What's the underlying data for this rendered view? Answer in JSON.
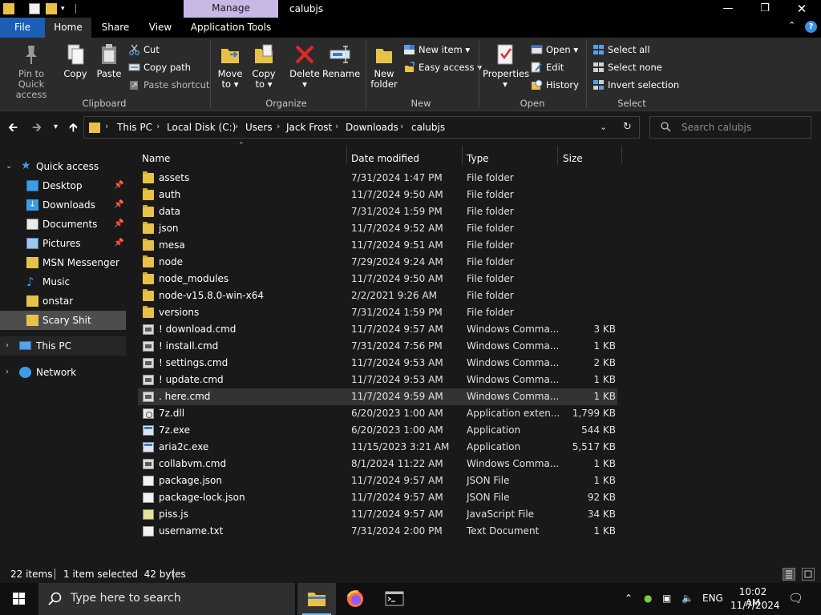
{
  "window": {
    "title": "calubjs",
    "contextual_tab_group": "Manage",
    "controls": [
      "minimize",
      "maximize",
      "close"
    ]
  },
  "ribbon_tabs": {
    "file": "File",
    "home": "Home",
    "share": "Share",
    "view": "View",
    "app_tools": "Application Tools"
  },
  "ribbon": {
    "clipboard": {
      "label": "Clipboard",
      "pin_line1": "Pin to Quick",
      "pin_line2": "access",
      "copy": "Copy",
      "paste": "Paste",
      "cut": "Cut",
      "copy_path": "Copy path",
      "paste_shortcut": "Paste shortcut"
    },
    "organize": {
      "label": "Organize",
      "move_line1": "Move",
      "move_line2": "to",
      "copy_line1": "Copy",
      "copy_line2": "to",
      "delete": "Delete",
      "rename": "Rename"
    },
    "new": {
      "label": "New",
      "new_folder_line1": "New",
      "new_folder_line2": "folder",
      "new_item": "New item",
      "easy_access": "Easy access"
    },
    "open": {
      "label": "Open",
      "properties": "Properties",
      "open": "Open",
      "edit": "Edit",
      "history": "History"
    },
    "select": {
      "label": "Select",
      "select_all": "Select all",
      "select_none": "Select none",
      "invert": "Invert selection"
    }
  },
  "address": {
    "crumbs": [
      "This PC",
      "Local Disk (C:)",
      "Users",
      "Jack Frost",
      "Downloads",
      "calubjs"
    ],
    "search_placeholder": "Search calubjs"
  },
  "navpane": {
    "quick_access": "Quick access",
    "items": [
      {
        "label": "Desktop",
        "icon": "desktop-icon",
        "pinned": true
      },
      {
        "label": "Downloads",
        "icon": "downloads-icon",
        "pinned": true
      },
      {
        "label": "Documents",
        "icon": "documents-icon",
        "pinned": true
      },
      {
        "label": "Pictures",
        "icon": "pictures-icon",
        "pinned": true
      },
      {
        "label": "MSN Messenger",
        "icon": "folder-icon",
        "pinned": false
      },
      {
        "label": "Music",
        "icon": "music-icon",
        "pinned": false
      },
      {
        "label": "onstar",
        "icon": "folder-icon",
        "pinned": false
      },
      {
        "label": "Scary Shit",
        "icon": "folder-icon",
        "pinned": false
      }
    ],
    "this_pc": "This PC",
    "network": "Network",
    "pin_glyph": "📌"
  },
  "columns": {
    "name": "Name",
    "date": "Date modified",
    "type": "Type",
    "size": "Size"
  },
  "files": [
    {
      "name": "assets",
      "date": "7/31/2024 1:47 PM",
      "type": "File folder",
      "size": "",
      "icon": "folder"
    },
    {
      "name": "auth",
      "date": "11/7/2024 9:50 AM",
      "type": "File folder",
      "size": "",
      "icon": "folder"
    },
    {
      "name": "data",
      "date": "7/31/2024 1:59 PM",
      "type": "File folder",
      "size": "",
      "icon": "folder"
    },
    {
      "name": "json",
      "date": "11/7/2024 9:52 AM",
      "type": "File folder",
      "size": "",
      "icon": "folder"
    },
    {
      "name": "mesa",
      "date": "11/7/2024 9:51 AM",
      "type": "File folder",
      "size": "",
      "icon": "folder"
    },
    {
      "name": "node",
      "date": "7/29/2024 9:24 AM",
      "type": "File folder",
      "size": "",
      "icon": "folder"
    },
    {
      "name": "node_modules",
      "date": "11/7/2024 9:50 AM",
      "type": "File folder",
      "size": "",
      "icon": "folder"
    },
    {
      "name": "node-v15.8.0-win-x64",
      "date": "2/2/2021 9:26 AM",
      "type": "File folder",
      "size": "",
      "icon": "folder"
    },
    {
      "name": "versions",
      "date": "7/31/2024 1:59 PM",
      "type": "File folder",
      "size": "",
      "icon": "folder"
    },
    {
      "name": "! download.cmd",
      "date": "11/7/2024 9:57 AM",
      "type": "Windows Comma...",
      "size": "3 KB",
      "icon": "cmd"
    },
    {
      "name": "! install.cmd",
      "date": "7/31/2024 7:56 PM",
      "type": "Windows Comma...",
      "size": "1 KB",
      "icon": "cmd"
    },
    {
      "name": "! settings.cmd",
      "date": "11/7/2024 9:53 AM",
      "type": "Windows Comma...",
      "size": "2 KB",
      "icon": "cmd"
    },
    {
      "name": "! update.cmd",
      "date": "11/7/2024 9:53 AM",
      "type": "Windows Comma...",
      "size": "1 KB",
      "icon": "cmd"
    },
    {
      "name": ". here.cmd",
      "date": "11/7/2024 9:59 AM",
      "type": "Windows Comma...",
      "size": "1 KB",
      "icon": "cmd",
      "selected": true
    },
    {
      "name": "7z.dll",
      "date": "6/20/2023 1:00 AM",
      "type": "Application exten...",
      "size": "1,799 KB",
      "icon": "dll"
    },
    {
      "name": "7z.exe",
      "date": "6/20/2023 1:00 AM",
      "type": "Application",
      "size": "544 KB",
      "icon": "exe"
    },
    {
      "name": "aria2c.exe",
      "date": "11/15/2023 3:21 AM",
      "type": "Application",
      "size": "5,517 KB",
      "icon": "exe"
    },
    {
      "name": "collabvm.cmd",
      "date": "8/1/2024 11:22 AM",
      "type": "Windows Comma...",
      "size": "1 KB",
      "icon": "cmd"
    },
    {
      "name": "package.json",
      "date": "11/7/2024 9:57 AM",
      "type": "JSON File",
      "size": "1 KB",
      "icon": "doc"
    },
    {
      "name": "package-lock.json",
      "date": "11/7/2024 9:57 AM",
      "type": "JSON File",
      "size": "92 KB",
      "icon": "doc"
    },
    {
      "name": "piss.js",
      "date": "11/7/2024 9:57 AM",
      "type": "JavaScript File",
      "size": "34 KB",
      "icon": "js"
    },
    {
      "name": "username.txt",
      "date": "7/31/2024 2:00 PM",
      "type": "Text Document",
      "size": "1 KB",
      "icon": "doc"
    }
  ],
  "status": {
    "item_count": "22 items",
    "selection": "1 item selected  42 bytes"
  },
  "taskbar": {
    "search_placeholder": "Type here to search",
    "apps": [
      "file-explorer-icon",
      "firefox-icon",
      "terminal-icon"
    ],
    "language": "ENG",
    "time": "10:02 AM",
    "date": "11/7/2024"
  },
  "colors": {
    "accent": "#1a5fb4",
    "background": "#191919",
    "ribbon": "#2b2b2b",
    "folder": "#e8c14a",
    "selection": "#333333"
  }
}
